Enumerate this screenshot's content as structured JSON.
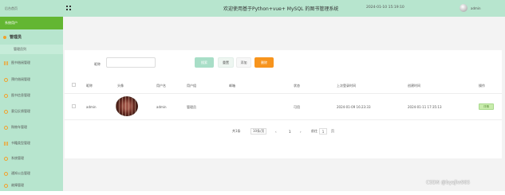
{
  "sidebar": {
    "home": "后台首页",
    "user_menu": "系统用户",
    "group": "管理员",
    "sub_item": "管理员列",
    "items": [
      {
        "label": "图书借阅管理",
        "icon": "bar-chart-icon"
      },
      {
        "label": "预约借阅管理",
        "icon": "circle-icon"
      },
      {
        "label": "图书信息管理",
        "icon": "circle-icon"
      },
      {
        "label": "意见反馈管理",
        "icon": "circle-icon"
      },
      {
        "label": "购物车管理",
        "icon": "circle-icon"
      },
      {
        "label": "书籍类型管理",
        "icon": "bar-chart-icon"
      },
      {
        "label": "系统管理",
        "icon": "circle-icon"
      },
      {
        "label": "通知公告管理",
        "icon": "circle-icon"
      },
      {
        "label": "故障管理",
        "icon": "circle-icon"
      }
    ]
  },
  "header": {
    "title": "欢迎使用基于Python+vue+ MySQL 的图书管理系统",
    "datetime": "2024-01-10 15:19:10",
    "username": "admin"
  },
  "search": {
    "label": "昵称",
    "value": "",
    "search_btn": "搜索",
    "reset_btn": "重置",
    "add_btn": "添加",
    "delete_btn": "删除"
  },
  "table": {
    "columns": [
      "昵称",
      "头像",
      "用户名",
      "用户组",
      "邮箱",
      "状态",
      "上次登录时间",
      "创建时间",
      "操作"
    ],
    "rows": [
      {
        "nickname": "admin",
        "username": "admin",
        "group": "管理员",
        "email": "",
        "status": "可用",
        "last_login": "2024-01-09 16:23:33",
        "created": "2024-01-11 17:35:13",
        "action": "详情"
      }
    ]
  },
  "pagination": {
    "total": "共1条",
    "page_size": "10条/页",
    "prev": "‹",
    "current": "1",
    "next": "›",
    "goto_label": "前往",
    "goto_value": "1",
    "page_suffix": "页"
  },
  "watermark": "CSDN @bysjlw985"
}
